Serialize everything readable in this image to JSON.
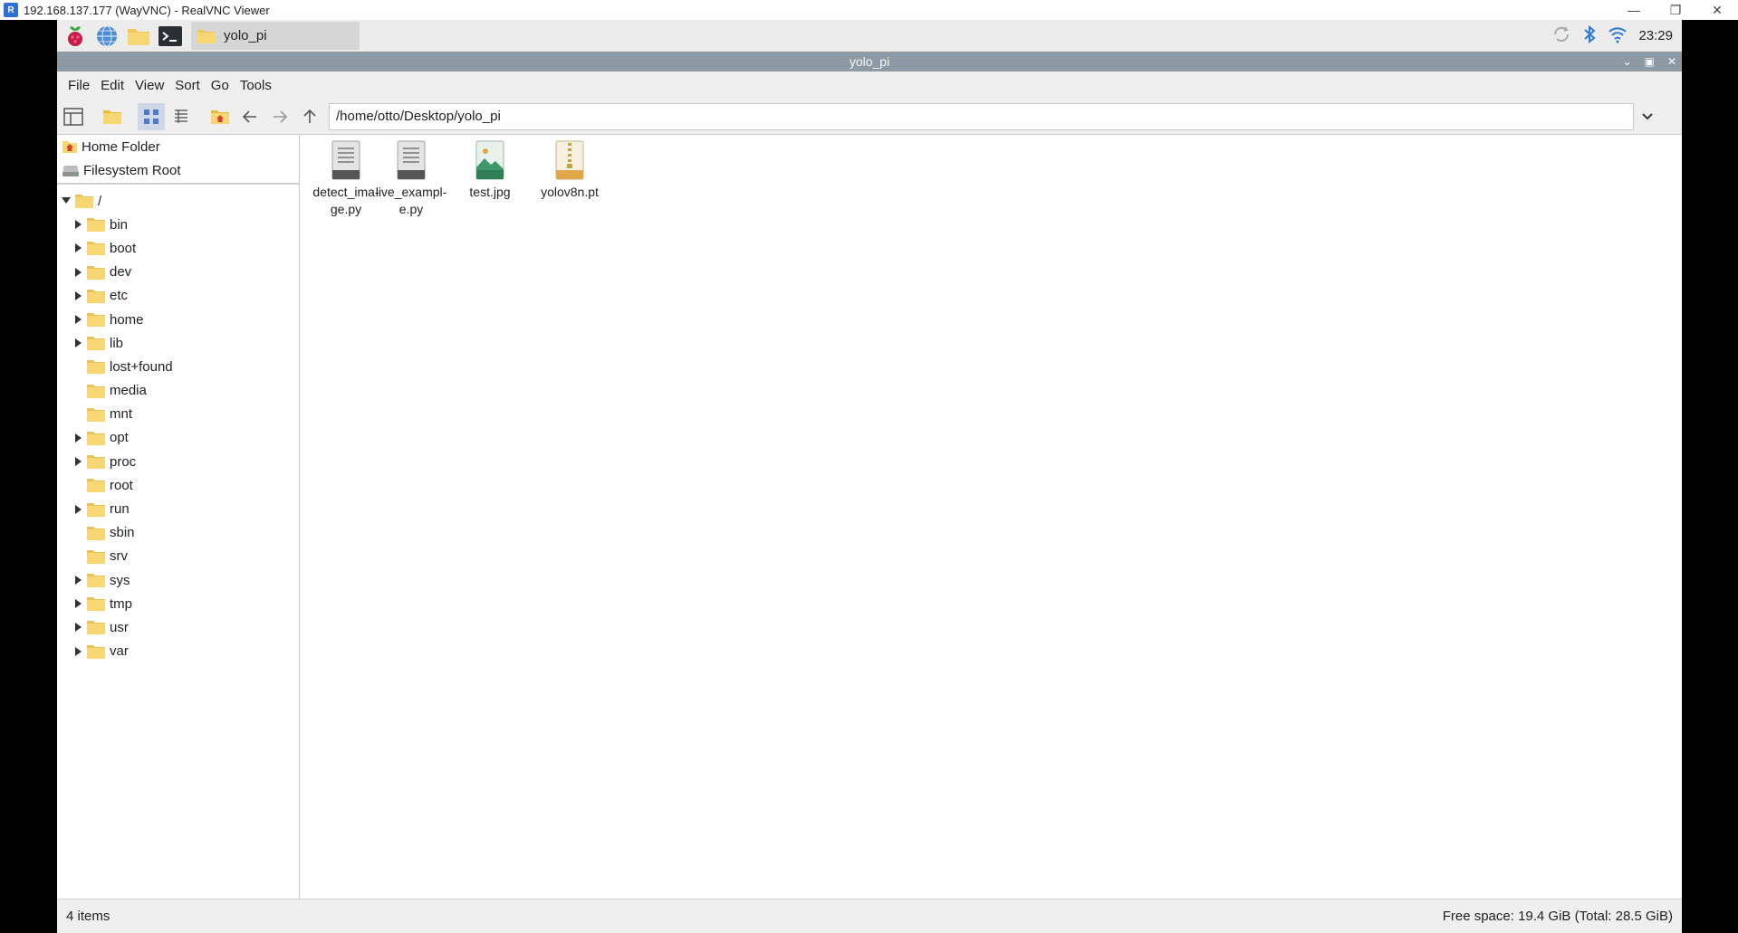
{
  "vnc": {
    "title": "192.168.137.177 (WayVNC) - RealVNC Viewer",
    "logo": "R"
  },
  "taskbar": {
    "task_label": "yolo_pi",
    "clock": "23:29"
  },
  "window": {
    "title": "yolo_pi"
  },
  "menu": {
    "file": "File",
    "edit": "Edit",
    "view": "View",
    "sort": "Sort",
    "go": "Go",
    "tools": "Tools"
  },
  "toolbar": {
    "path": "/home/otto/Desktop/yolo_pi"
  },
  "places": {
    "home": "Home Folder",
    "root": "Filesystem Root"
  },
  "tree": {
    "root": "/",
    "items": [
      {
        "label": "bin",
        "expandable": true
      },
      {
        "label": "boot",
        "expandable": true
      },
      {
        "label": "dev",
        "expandable": true
      },
      {
        "label": "etc",
        "expandable": true
      },
      {
        "label": "home",
        "expandable": true
      },
      {
        "label": "lib",
        "expandable": true
      },
      {
        "label": "lost+found",
        "expandable": false
      },
      {
        "label": "media",
        "expandable": false
      },
      {
        "label": "mnt",
        "expandable": false
      },
      {
        "label": "opt",
        "expandable": true
      },
      {
        "label": "proc",
        "expandable": true
      },
      {
        "label": "root",
        "expandable": false
      },
      {
        "label": "run",
        "expandable": true
      },
      {
        "label": "sbin",
        "expandable": false
      },
      {
        "label": "srv",
        "expandable": false
      },
      {
        "label": "sys",
        "expandable": true
      },
      {
        "label": "tmp",
        "expandable": true
      },
      {
        "label": "usr",
        "expandable": true
      },
      {
        "label": "var",
        "expandable": true
      }
    ]
  },
  "files": [
    {
      "line1": "detect_ima-",
      "line2": "ge.py",
      "icon": "text-file-icon"
    },
    {
      "line1": "live_exampl-",
      "line2": "e.py",
      "icon": "text-file-icon"
    },
    {
      "line1": "test.jpg",
      "line2": "",
      "icon": "image-file-icon"
    },
    {
      "line1": "yolov8n.pt",
      "line2": "",
      "icon": "archive-file-icon"
    }
  ],
  "status": {
    "items": "4 items",
    "free_space": "Free space: 19.4 GiB (Total: 28.5 GiB)"
  },
  "colors": {
    "title_bar": "#8d9aa5",
    "folder": "#f7d774",
    "accent": "#2f6fd6"
  }
}
